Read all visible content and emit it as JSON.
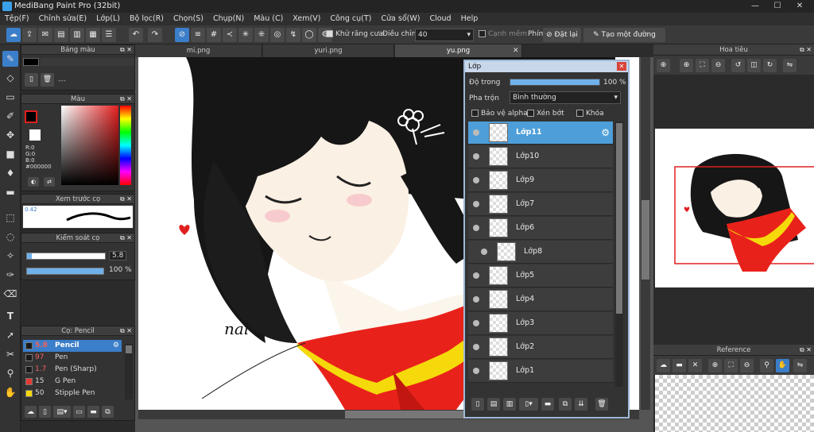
{
  "window": {
    "title": "MediBang Paint Pro (32bit)"
  },
  "menu": [
    "Tệp(F)",
    "Chỉnh sửa(E)",
    "Lớp(L)",
    "Bộ lọc(R)",
    "Chọn(S)",
    "Chụp(N)",
    "Màu (C)",
    "Xem(V)",
    "Công cụ(T)",
    "Cửa sổ(W)",
    "Cloud",
    "Help"
  ],
  "toolbar": {
    "antialias_label": "Khử răng cưa",
    "adjust_label": "Điều chỉnh",
    "adjust_value": "40",
    "sharp_edge_label": "Cạnh mềm",
    "shortcut_label": "Phím",
    "reset_label": "Đặt lại",
    "ruler_label": "Tạo một đường thẳng"
  },
  "panels": {
    "palette_title": "Bảng màu",
    "palette_value": "---",
    "color_title": "Màu",
    "rgb": {
      "r": "R:0",
      "g": "G:0",
      "b": "B:0",
      "hex": "#000000"
    },
    "brush_preview_title": "Xem trước cọ",
    "brush_preview_size": "0.42",
    "brush_control_title": "Kiểm soát cọ",
    "brush_size": "5.8",
    "brush_size_fraction": 0.06,
    "brush_opacity": "100 %",
    "brush_opacity_fraction": 1.0,
    "brush_list_title": "Cọ: Pencil",
    "brushes": [
      {
        "size": "5.8",
        "name": "Pencil",
        "color": "#1a1a1a",
        "selected": true
      },
      {
        "size": "97",
        "name": "Pen",
        "color": "#1a1a1a",
        "selected": false
      },
      {
        "size": "1.7",
        "name": "Pen (Sharp)",
        "color": "#1a1a1a",
        "selected": false
      },
      {
        "size": "15",
        "name": "G Pen",
        "color": "#e53935",
        "selected": false
      },
      {
        "size": "50",
        "name": "Stipple Pen",
        "color": "#f5d90a",
        "selected": false
      }
    ]
  },
  "tabs": [
    "mi.png",
    "yuri.png",
    "yu.png"
  ],
  "canvas": {
    "signature": "nai"
  },
  "layers_window": {
    "title": "Lớp",
    "opacity_label": "Độ trong",
    "opacity_value": "100 %",
    "opacity_fraction": 1.0,
    "blend_label": "Pha trộn",
    "blend_value": "Bình thường",
    "protect_alpha": "Bảo vệ alpha",
    "clipping": "Xén bớt",
    "lock": "Khóa",
    "layers": [
      {
        "name": "Lớp11",
        "selected": true
      },
      {
        "name": "Lớp10",
        "selected": false
      },
      {
        "name": "Lớp9",
        "selected": false
      },
      {
        "name": "Lớp7",
        "selected": false
      },
      {
        "name": "Lớp6",
        "selected": false
      },
      {
        "name": "Lớp8",
        "selected": false
      },
      {
        "name": "Lớp5",
        "selected": false
      },
      {
        "name": "Lớp4",
        "selected": false
      },
      {
        "name": "Lớp3",
        "selected": false
      },
      {
        "name": "Lớp2",
        "selected": false
      },
      {
        "name": "Lớp1",
        "selected": false
      }
    ]
  },
  "navigator": {
    "title": "Hoa tiêu"
  },
  "reference": {
    "title": "Reference"
  },
  "colors": {
    "accent": "#3b7ec9",
    "selected_layer": "#4d9ed9",
    "hair": "#161616",
    "uniform": "#e8221a",
    "collar_trim": "#f5d90a"
  }
}
